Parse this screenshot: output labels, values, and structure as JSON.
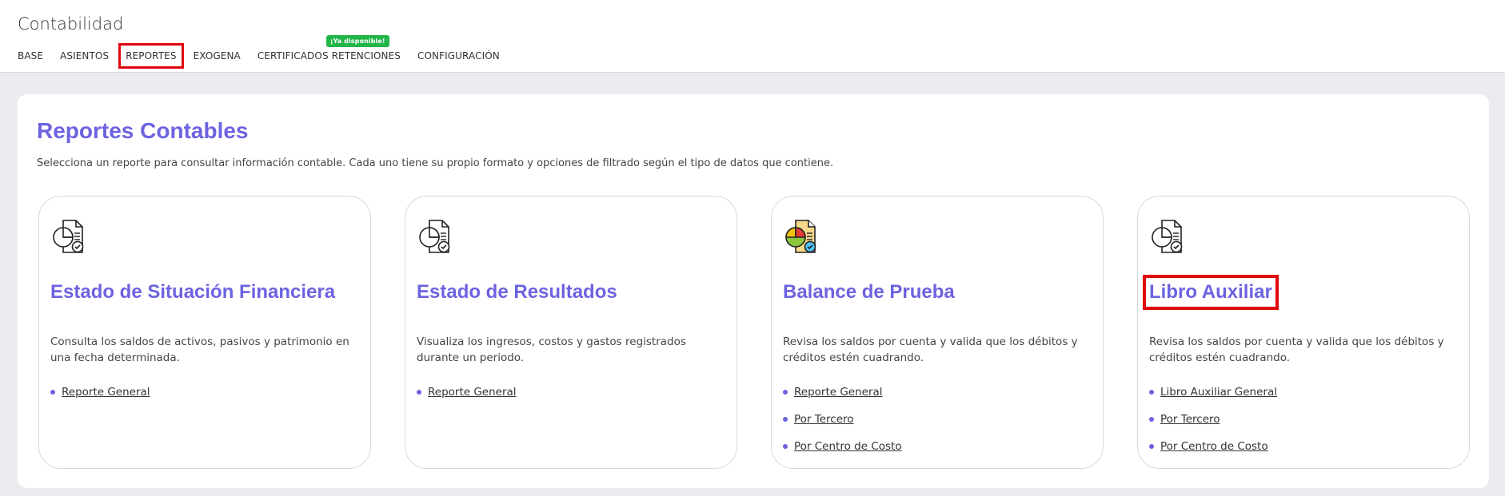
{
  "app": {
    "title": "Contabilidad"
  },
  "nav": {
    "tabs": [
      {
        "label": "BASE"
      },
      {
        "label": "ASIENTOS"
      },
      {
        "label": "REPORTES",
        "selected": true
      },
      {
        "label": "EXOGENA"
      },
      {
        "label": "CERTIFICADOS RETENCIONES",
        "badge": "¡Ya disponible!"
      },
      {
        "label": "CONFIGURACIÓN"
      }
    ]
  },
  "main": {
    "title": "Reportes Contables",
    "description": "Selecciona un reporte para consultar información contable. Cada uno tiene su propio formato y opciones de filtrado según el tipo de datos que contiene.",
    "cards": [
      {
        "icon": "report-chart-icon",
        "title": "Estado de Situación Financiera",
        "description": "Consulta los saldos de activos, pasivos y patrimonio en una fecha determinada.",
        "links": [
          "Reporte General"
        ]
      },
      {
        "icon": "report-chart-icon",
        "title": "Estado de Resultados",
        "description": "Visualiza los ingresos, costos y gastos registrados durante un periodo.",
        "links": [
          "Reporte General"
        ]
      },
      {
        "icon": "color-report-chart-icon",
        "title": "Balance de Prueba",
        "description": "Revisa los saldos por cuenta y valida que los débitos y créditos estén cuadrando.",
        "links": [
          "Reporte General",
          "Por Tercero",
          "Por Centro de Costo"
        ]
      },
      {
        "icon": "report-chart-icon",
        "title": "Libro Auxiliar",
        "description": "Revisa los saldos por cuenta y valida que los débitos y créditos estén cuadrando.",
        "links": [
          "Libro Auxiliar General",
          "Por Tercero",
          "Por Centro de Costo"
        ]
      }
    ]
  },
  "colors": {
    "accent": "#6c63e0",
    "badge": "#22b547",
    "highlight": "#e0060e"
  }
}
